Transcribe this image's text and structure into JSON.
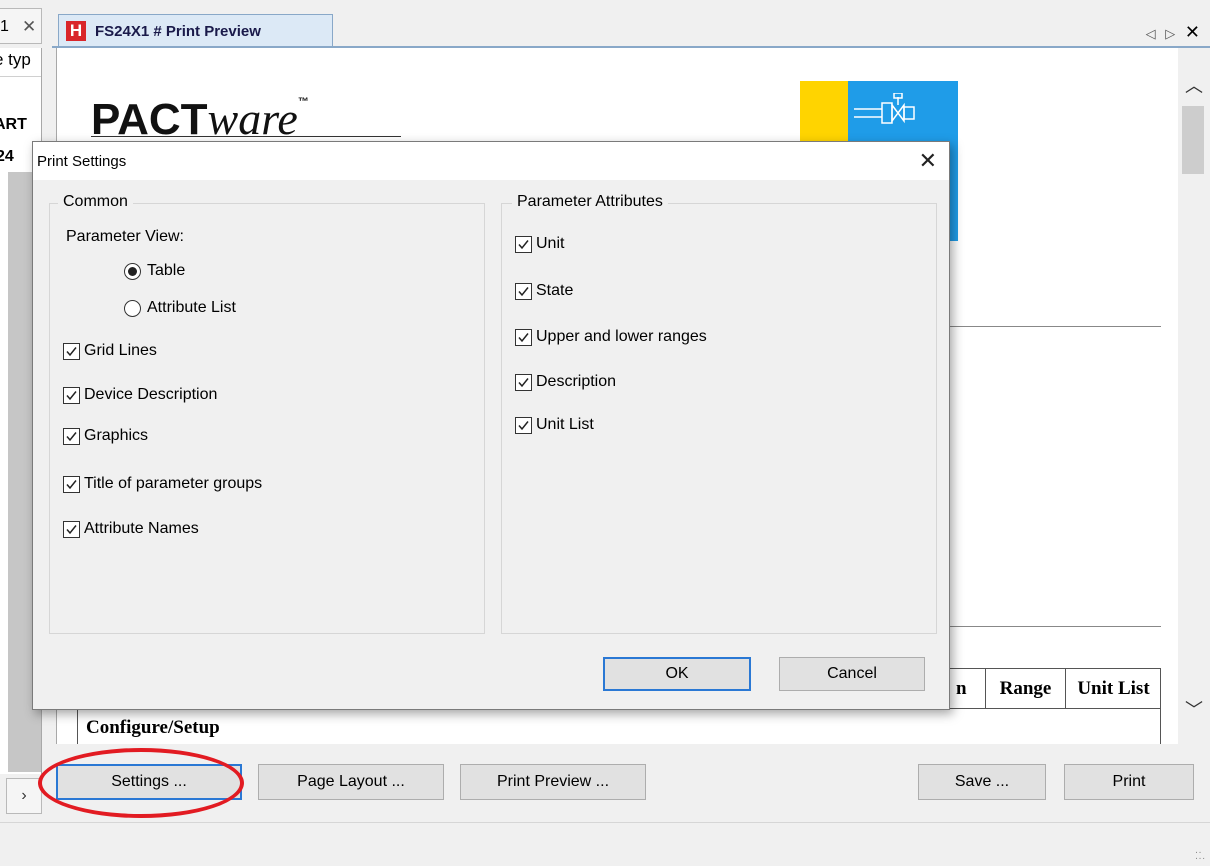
{
  "left_pane": {
    "tab_label": "1",
    "line1": "e typ",
    "line2": "ART",
    "line3": "24",
    "scroll_right_icon": "chevron-right-icon"
  },
  "doc_tab": {
    "icon_letter": "H",
    "title": "FS24X1  # Print Preview",
    "nav_left": "◁",
    "nav_right": "▷",
    "close": "✕"
  },
  "preview": {
    "logo_text": "PACT",
    "logo_italic": "ware",
    "logo_tm": "™",
    "table_headers": [
      "n",
      "Range",
      "Unit List"
    ],
    "section_title": "Configure/Setup"
  },
  "scrollbar": {
    "up_icon": "chevron-up-icon",
    "down_icon": "chevron-down-icon"
  },
  "bottom_buttons": {
    "settings": "Settings ...",
    "page_layout": "Page Layout ...",
    "print_preview": "Print Preview ...",
    "save": "Save ...",
    "print": "Print"
  },
  "dialog": {
    "title": "Print Settings",
    "close": "✕",
    "common": {
      "legend": "Common",
      "parameter_view_label": "Parameter View:",
      "radio_options": [
        {
          "label": "Table",
          "selected": true
        },
        {
          "label": "Attribute List",
          "selected": false
        }
      ],
      "checkboxes": [
        {
          "label": "Grid Lines",
          "checked": true
        },
        {
          "label": "Device Description",
          "checked": true
        },
        {
          "label": "Graphics",
          "checked": true
        },
        {
          "label": "Title of parameter groups",
          "checked": true
        },
        {
          "label": "Attribute Names",
          "checked": true
        }
      ]
    },
    "attributes": {
      "legend": "Parameter Attributes",
      "checkboxes": [
        {
          "label": "Unit",
          "checked": true
        },
        {
          "label": "State",
          "checked": true
        },
        {
          "label": "Upper and lower ranges",
          "checked": true
        },
        {
          "label": "Description",
          "checked": true
        },
        {
          "label": "Unit List",
          "checked": true
        }
      ]
    },
    "ok": "OK",
    "cancel": "Cancel"
  },
  "colors": {
    "focus_blue": "#2a78d4",
    "highlight_red": "#e21b22",
    "logo_yellow": "#ffd400",
    "logo_blue": "#1f9ce8",
    "h_logo_red": "#d9262b"
  }
}
